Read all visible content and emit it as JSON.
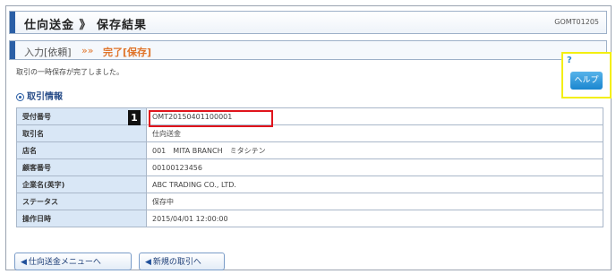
{
  "header": {
    "title": "仕向送金 》 保存結果",
    "screen_id": "GOMT01205"
  },
  "steps": {
    "step1": "入力[依頼]",
    "separator": "»»",
    "step2": "完了[保存]"
  },
  "message": "取引の一時保存が完了しました。",
  "help": {
    "label": "ヘルプ",
    "mark": "?"
  },
  "section": {
    "title": "取引情報"
  },
  "badge": "1",
  "table": [
    {
      "label": "受付番号",
      "value": "OMT20150401100001"
    },
    {
      "label": "取引名",
      "value": "仕向送金"
    },
    {
      "label": "店名",
      "value": "001　MITA BRANCH　ミタシテン"
    },
    {
      "label": "顧客番号",
      "value": "00100123456"
    },
    {
      "label": "企業名(英字)",
      "value": "ABC TRADING CO., LTD."
    },
    {
      "label": "ステータス",
      "value": "保存中"
    },
    {
      "label": "操作日時",
      "value": "2015/04/01 12:00:00"
    }
  ],
  "buttons": {
    "back_menu": "仕向送金メニューへ",
    "new_transaction": "新規の取引へ"
  },
  "colors": {
    "accent": "#2b5fa6",
    "step_active": "#e0742a",
    "highlight": "#e0141c",
    "label_bg": "#d9e7f6",
    "help_frame": "#f3ef10"
  }
}
